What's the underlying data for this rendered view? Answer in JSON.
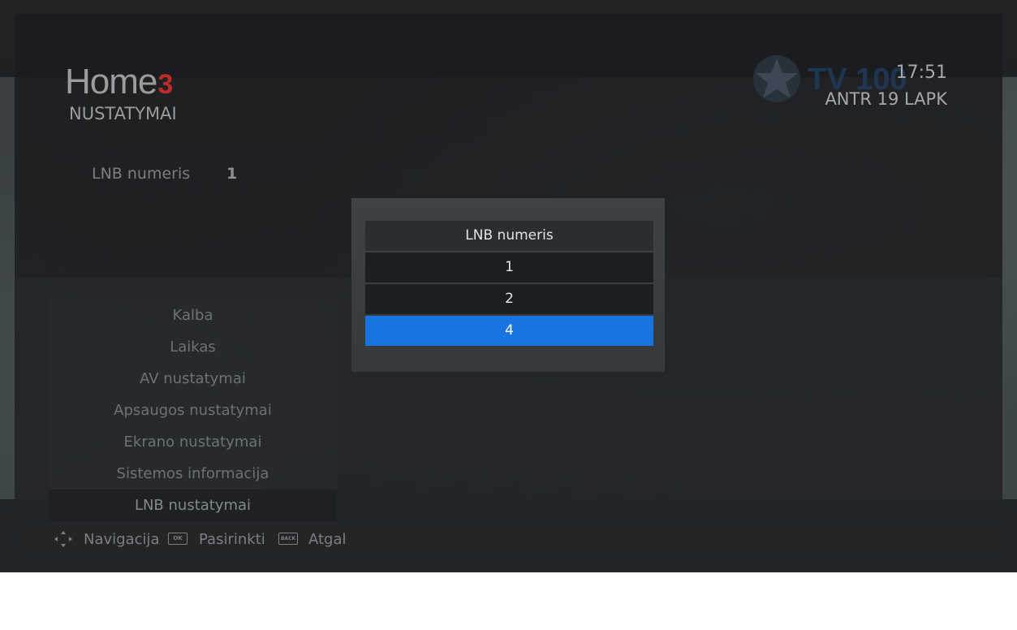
{
  "header": {
    "logo_text": "Home",
    "logo_mark": "3",
    "page_title": "NUSTATYMAI",
    "channel_logo_text": "TV 100",
    "clock": "17:51",
    "date": "ANTR 19 LAPK"
  },
  "current_setting": {
    "label": "LNB numeris",
    "value": "1"
  },
  "menu": {
    "items": [
      {
        "label": "Kalba"
      },
      {
        "label": "Laikas"
      },
      {
        "label": "AV nustatymai"
      },
      {
        "label": "Apsaugos nustatymai"
      },
      {
        "label": "Ekrano nustatymai"
      },
      {
        "label": "Sistemos informacija"
      },
      {
        "label": "LNB nustatymai"
      }
    ],
    "active_index": 6
  },
  "popup": {
    "title": "LNB numeris",
    "options": [
      "1",
      "2",
      "4"
    ],
    "selected_index": 2,
    "selected_color": "#1874e0"
  },
  "footer": {
    "hints": [
      {
        "icon": "dpad-icon",
        "label": "Navigacija"
      },
      {
        "icon": "ok-key-icon",
        "icon_text": "OK",
        "label": "Pasirinkti"
      },
      {
        "icon": "back-key-icon",
        "icon_text": "BACK",
        "label": "Atgal"
      }
    ]
  }
}
